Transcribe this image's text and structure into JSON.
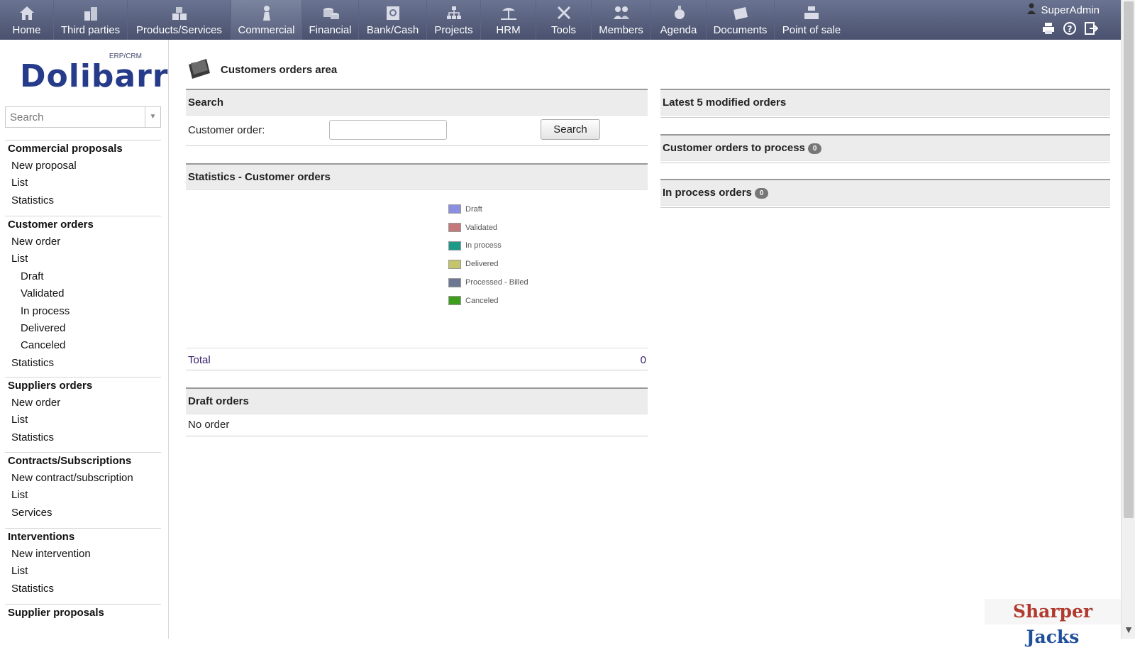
{
  "topmenu": {
    "items": [
      {
        "label": "Home",
        "icon": "home-icon"
      },
      {
        "label": "Third parties",
        "icon": "buildings-icon"
      },
      {
        "label": "Products/Services",
        "icon": "boxes-icon"
      },
      {
        "label": "Commercial",
        "icon": "commercial-icon",
        "active": true
      },
      {
        "label": "Financial",
        "icon": "coins-icon"
      },
      {
        "label": "Bank/Cash",
        "icon": "safe-icon"
      },
      {
        "label": "Projects",
        "icon": "org-chart-icon"
      },
      {
        "label": "HRM",
        "icon": "beach-icon"
      },
      {
        "label": "Tools",
        "icon": "tools-icon"
      },
      {
        "label": "Members",
        "icon": "members-icon"
      },
      {
        "label": "Agenda",
        "icon": "agenda-icon"
      },
      {
        "label": "Documents",
        "icon": "documents-icon"
      },
      {
        "label": "Point of sale",
        "icon": "cash-register-icon"
      }
    ],
    "user": "SuperAdmin"
  },
  "sidebar": {
    "logo_text": "Dolibarr",
    "logo_sub": "ERP/CRM",
    "search_placeholder": "Search",
    "sections": [
      {
        "title": "Commercial proposals",
        "items": [
          "New proposal",
          "List",
          "Statistics"
        ]
      },
      {
        "title": "Customer orders",
        "items": [
          "New order",
          "List",
          "Draft",
          "Validated",
          "In process",
          "Delivered",
          "Canceled",
          "Statistics"
        ]
      },
      {
        "title": "Suppliers orders",
        "items": [
          "New order",
          "List",
          "Statistics"
        ]
      },
      {
        "title": "Contracts/Subscriptions",
        "items": [
          "New contract/subscription",
          "List",
          "Services"
        ]
      },
      {
        "title": "Interventions",
        "items": [
          "New intervention",
          "List",
          "Statistics"
        ]
      },
      {
        "title": "Supplier proposals",
        "items": []
      }
    ]
  },
  "main": {
    "page_title": "Customers orders area",
    "search": {
      "title": "Search",
      "field_label": "Customer order:",
      "field_value": "",
      "button": "Search"
    },
    "stats": {
      "title": "Statistics - Customer orders",
      "legend": [
        {
          "label": "Draft",
          "color": "#8b8fde"
        },
        {
          "label": "Validated",
          "color": "#c47a7a"
        },
        {
          "label": "In process",
          "color": "#1c9a87"
        },
        {
          "label": "Delivered",
          "color": "#c4c46a"
        },
        {
          "label": "Processed - Billed",
          "color": "#6f7893"
        },
        {
          "label": "Canceled",
          "color": "#3e9e1e"
        }
      ],
      "total_label": "Total",
      "total_value": "0"
    },
    "draft": {
      "title": "Draft orders",
      "empty": "No order"
    },
    "latest": {
      "title": "Latest 5 modified orders"
    },
    "to_process": {
      "title": "Customer orders to process",
      "count": "0"
    },
    "in_process": {
      "title": "In process orders",
      "count": "0"
    }
  },
  "watermark": {
    "part1": "Sharper",
    "part2": "Jacks"
  }
}
